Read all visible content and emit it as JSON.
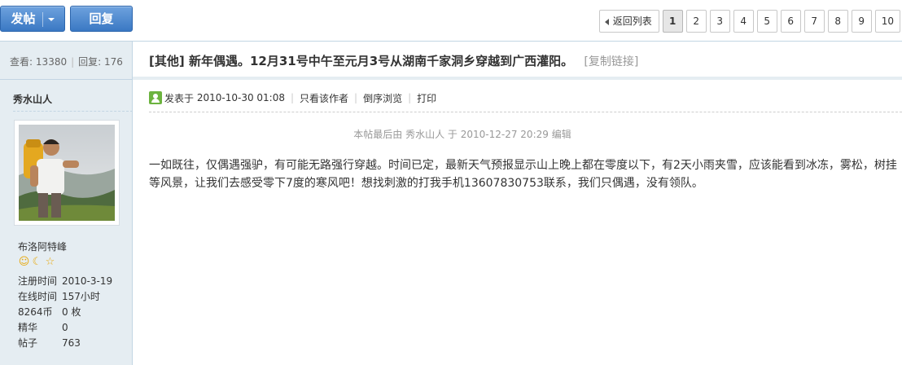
{
  "toolbar": {
    "post_label": "发帖",
    "reply_label": "回复"
  },
  "pager": {
    "back_label": "返回列表",
    "pages": [
      "1",
      "2",
      "3",
      "4",
      "5",
      "6",
      "7",
      "8",
      "9",
      "10"
    ],
    "current": "1"
  },
  "stats": {
    "views_label": "查看:",
    "views": "13380",
    "replies_label": "回复:",
    "replies": "176"
  },
  "thread": {
    "category": "[其他]",
    "title": "新年偶遇。12月31号中午至元月3号从湖南千家洞乡穿越到广西灌阳。",
    "copy_link": "[复制链接]"
  },
  "post_meta": {
    "posted_label": "发表于",
    "posted_time": "2010-10-30 01:08",
    "only_author": "只看该作者",
    "reverse_browse": "倒序浏览",
    "print": "打印"
  },
  "edited_note": "本帖最后由 秀水山人 于 2010-12-27 20:29 编辑",
  "content": "一如既往，仅偶遇强驴，有可能无路强行穿越。时间已定，最新天气预报显示山上晚上都在零度以下，有2天小雨夹雪，应该能看到冰冻，雾松，树挂等风景，让我们去感受零下7度的寒风吧！想找刺激的打我手机13607830753联系，我们只偶遇，没有领队。",
  "author": {
    "name": "秀水山人",
    "group": "布洛阿特峰",
    "medals": [
      "smile-icon",
      "moon-icon",
      "star-icon"
    ],
    "info": [
      {
        "k": "注册时间",
        "v": "2010-3-19"
      },
      {
        "k": "在线时间",
        "v": "157小时"
      },
      {
        "k": "8264币",
        "v": "0 枚"
      },
      {
        "k": "精华",
        "v": "0"
      },
      {
        "k": "帖子",
        "v": "763"
      }
    ]
  },
  "colors": {
    "accent_blue": "#3a78c3",
    "sidebar_bg": "#e5edf2",
    "border": "#c2d5e3"
  }
}
